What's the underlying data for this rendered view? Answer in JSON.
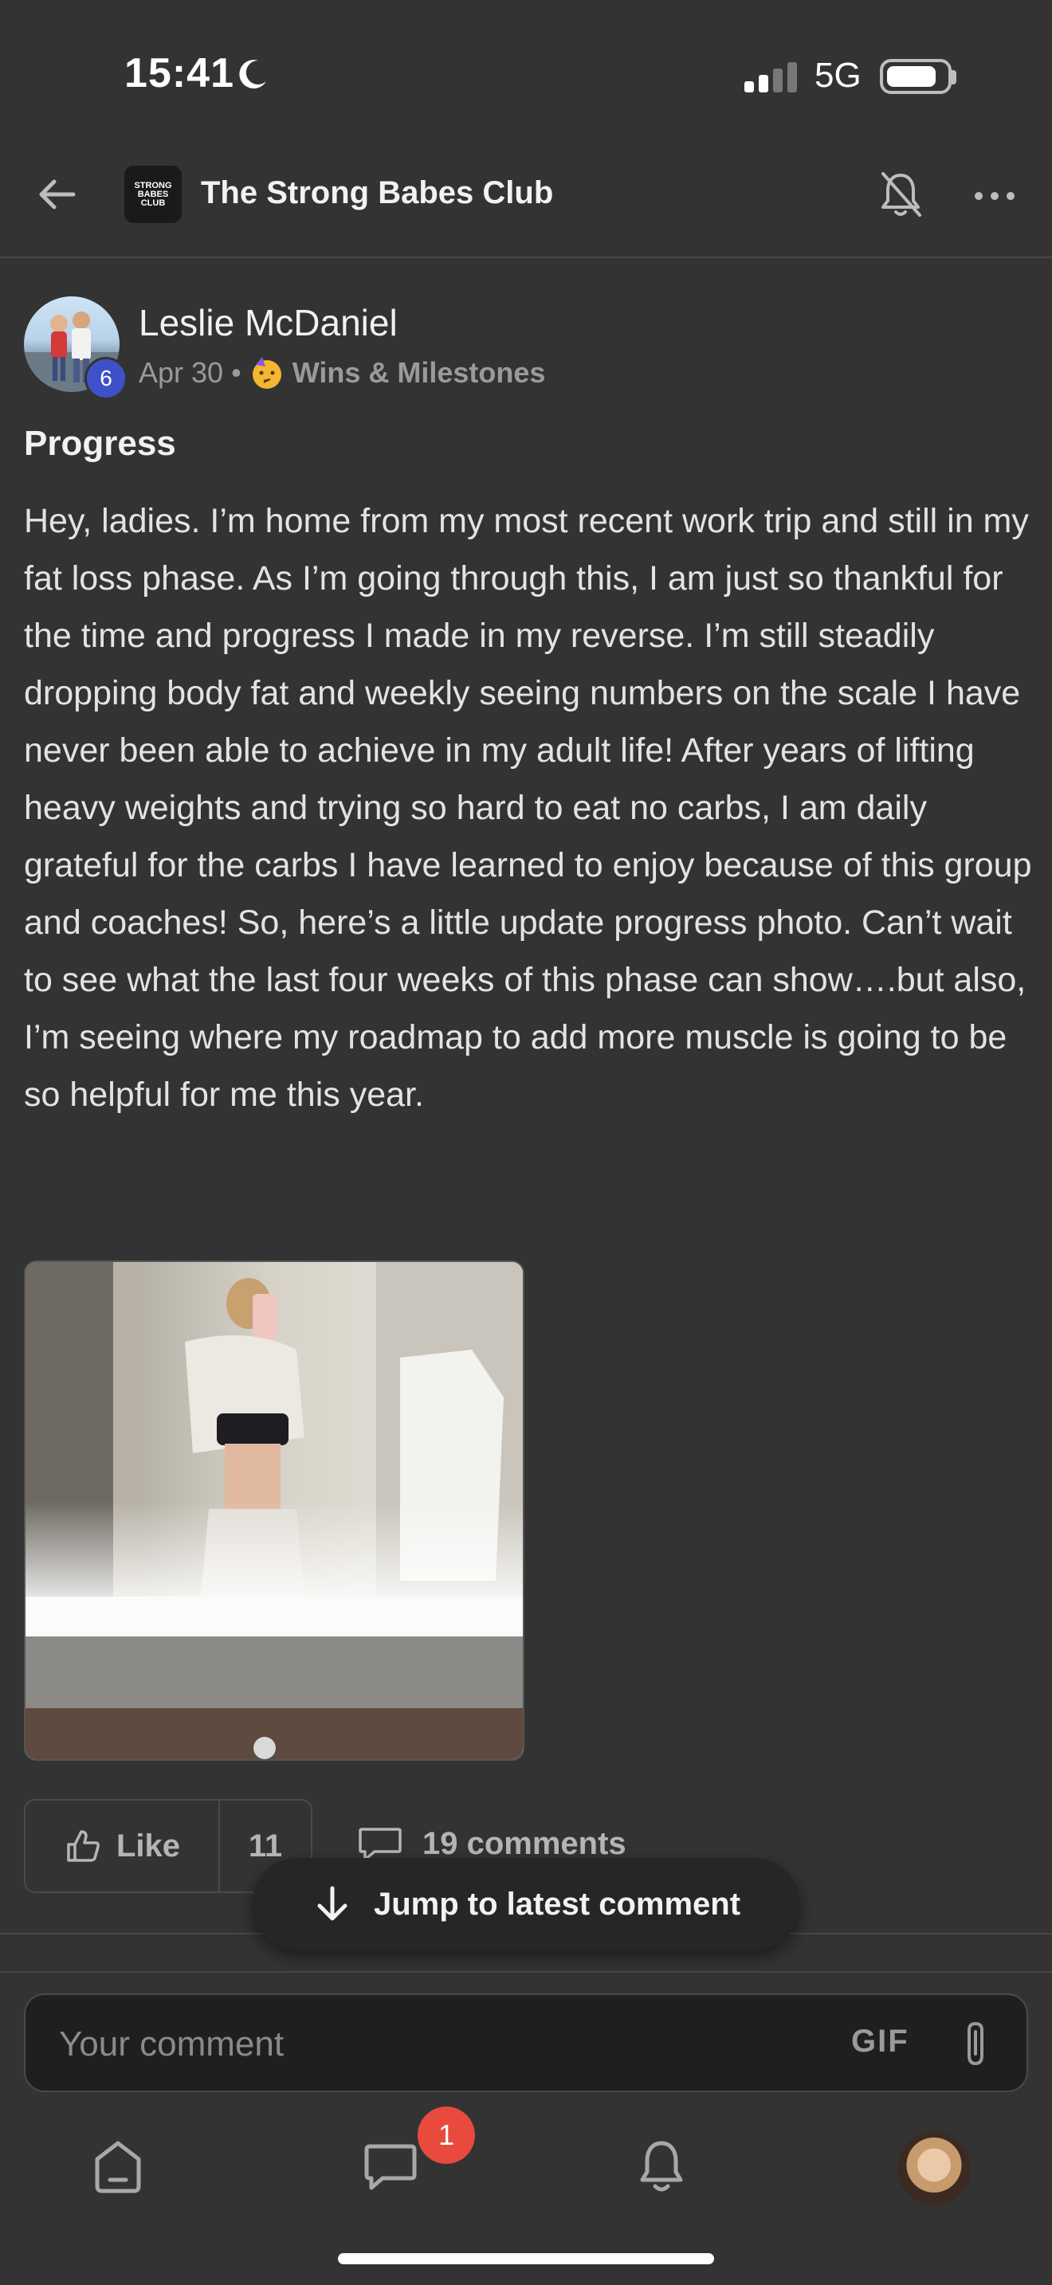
{
  "status_bar": {
    "time": "15:41",
    "network": "5G",
    "battery_level": 0.85
  },
  "header": {
    "club_name": "The Strong Babes Club",
    "logo_text": [
      "STRONG",
      "BABES",
      "CLUB"
    ]
  },
  "post": {
    "author": "Leslie McDaniel",
    "level": "6",
    "date": "Apr 30",
    "separator": "•",
    "category": "Wins & Milestones",
    "title": "Progress",
    "body": "Hey, ladies. I’m home from my most recent work trip and still in my fat loss phase. As I’m going through this, I am just so thankful for the time and progress I made in my reverse. I’m still steadily dropping body fat and weekly seeing numbers on the scale I have never been able to achieve in my adult life! After years of lifting heavy weights and trying so hard to eat no carbs, I am daily grateful for the carbs I have learned to enjoy because of this group and coaches! So, here’s a little update progress photo. Can’t wait to see what the last four weeks of this phase can show….but also, I’m seeing where my roadmap to add more muscle is going to be so helpful for me this year."
  },
  "actions": {
    "like_label": "Like",
    "like_count": "11",
    "comments_label": "19 comments",
    "jump_label": "Jump to latest comment"
  },
  "comment_input": {
    "placeholder": "Your comment",
    "gif_label": "GIF"
  },
  "tab_bar": {
    "messages_badge": "1"
  }
}
